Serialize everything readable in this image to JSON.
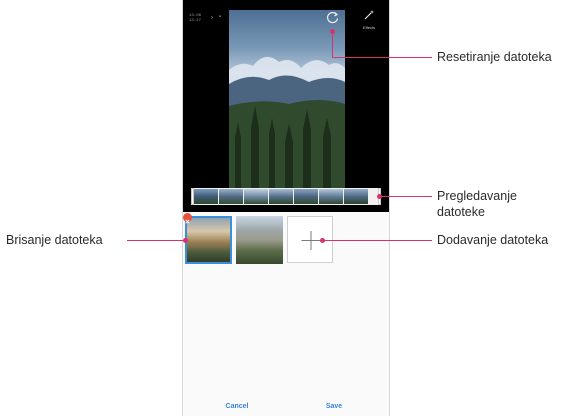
{
  "status": {
    "time_line1": "13:08",
    "time_line2": "13:27"
  },
  "editor": {
    "wand_label": "Effects"
  },
  "icons": {
    "wand": "magic-wand-icon",
    "reset": "reset-icon",
    "add": "plus-icon",
    "delete": "close-icon"
  },
  "thumbnails": [
    {
      "kind": "photo",
      "selected": true
    },
    {
      "kind": "photo",
      "selected": false
    },
    {
      "kind": "add"
    }
  ],
  "bottom_bar": {
    "cancel_label": "Cancel",
    "save_label": "Save"
  },
  "callouts": {
    "reset": "Resetiranje datoteka",
    "preview_line1": "Pregledavanje",
    "preview_line2": "datoteke",
    "delete": "Brisanje datoteka",
    "add": "Dodavanje datoteka"
  },
  "colors": {
    "accent": "#3b82e0",
    "callout": "#d6336c",
    "delete_badge": "#e8503a",
    "selected_border": "#3b8fd6"
  }
}
